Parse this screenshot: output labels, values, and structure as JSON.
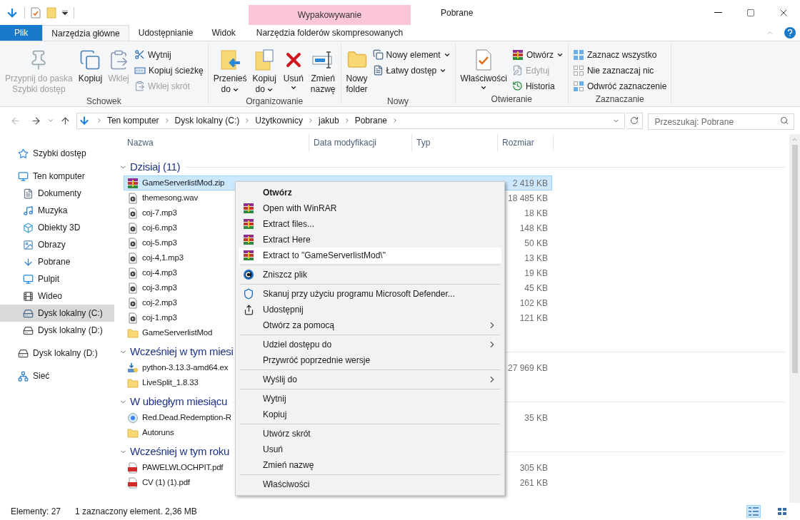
{
  "window": {
    "title": "Pobrane",
    "context_header": "Wypakowywanie"
  },
  "tabs": [
    {
      "label": "Plik",
      "kind": "file",
      "selected": false
    },
    {
      "label": "Narzędzia główne",
      "kind": "tab",
      "selected": true
    },
    {
      "label": "Udostępnianie",
      "kind": "tab",
      "selected": false
    },
    {
      "label": "Widok",
      "kind": "tab",
      "selected": false
    },
    {
      "label": "Narzędzia folderów skompresowanych",
      "kind": "context",
      "selected": false
    }
  ],
  "ribbon": [
    {
      "label": "Schowek",
      "large": [
        {
          "lines": [
            "Przypnij do paska",
            "Szybki dostęp"
          ],
          "kind": "pin",
          "disabled": true,
          "dropdown": false
        },
        {
          "lines": [
            "Kopiuj"
          ],
          "kind": "copy",
          "disabled": false,
          "dropdown": false
        },
        {
          "lines": [
            "Wklej"
          ],
          "kind": "paste",
          "disabled": true,
          "dropdown": false
        }
      ],
      "small": [
        {
          "label": "Wytnij",
          "kind": "cut",
          "disabled": false,
          "dropdown": false
        },
        {
          "label": "Kopiuj ścieżkę",
          "kind": "path",
          "disabled": false,
          "dropdown": false
        },
        {
          "label": "Wklej skrót",
          "kind": "shortcut",
          "disabled": true,
          "dropdown": false
        }
      ]
    },
    {
      "label": "Organizowanie",
      "large": [
        {
          "lines": [
            "Przenieś",
            "do"
          ],
          "kind": "move",
          "disabled": false,
          "dropdown": true
        },
        {
          "lines": [
            "Kopiuj",
            "do"
          ],
          "kind": "copyto",
          "disabled": false,
          "dropdown": true
        },
        {
          "lines": [
            "Usuń"
          ],
          "kind": "delete",
          "disabled": false,
          "dropdown": true
        },
        {
          "lines": [
            "Zmień",
            "nazwę"
          ],
          "kind": "rename",
          "disabled": false,
          "dropdown": false
        }
      ]
    },
    {
      "label": "Nowy",
      "large": [
        {
          "lines": [
            "Nowy",
            "folder"
          ],
          "kind": "folder",
          "disabled": false,
          "dropdown": false
        }
      ],
      "small": [
        {
          "label": "Nowy element",
          "kind": "newitem",
          "disabled": false,
          "dropdown": true
        },
        {
          "label": "Łatwy dostęp",
          "kind": "easy",
          "disabled": false,
          "dropdown": true
        }
      ]
    },
    {
      "label": "Otwieranie",
      "large": [
        {
          "lines": [
            "Właściwości"
          ],
          "kind": "properties",
          "disabled": false,
          "dropdown": true
        }
      ],
      "small": [
        {
          "label": "Otwórz",
          "kind": "winrar",
          "disabled": false,
          "dropdown": true
        },
        {
          "label": "Edytuj",
          "kind": "edit",
          "disabled": true,
          "dropdown": false
        },
        {
          "label": "Historia",
          "kind": "history",
          "disabled": false,
          "dropdown": false
        }
      ]
    },
    {
      "label": "Zaznaczanie",
      "small": [
        {
          "label": "Zaznacz wszystko",
          "kind": "selectall",
          "disabled": false,
          "dropdown": false
        },
        {
          "label": "Nie zaznaczaj nic",
          "kind": "selectnone",
          "disabled": false,
          "dropdown": false
        },
        {
          "label": "Odwróć zaznaczenie",
          "kind": "invert",
          "disabled": false,
          "dropdown": false
        }
      ]
    }
  ],
  "address": {
    "path": [
      "Ten komputer",
      "Dysk lokalny (C:)",
      "Użytkownicy",
      "jakub",
      "Pobrane"
    ],
    "search_placeholder": "Przeszukaj: Pobrane"
  },
  "sidebar": {
    "items": [
      {
        "label": "Szybki dostęp",
        "kind": "star",
        "selected": false
      },
      {
        "label": "Ten komputer",
        "kind": "pc",
        "selected": false,
        "children": [
          {
            "label": "Dokumenty",
            "kind": "docs",
            "selected": false
          },
          {
            "label": "Muzyka",
            "kind": "music",
            "selected": false
          },
          {
            "label": "Obiekty 3D",
            "kind": "cube",
            "selected": false
          },
          {
            "label": "Obrazy",
            "kind": "images",
            "selected": false
          },
          {
            "label": "Pobrane",
            "kind": "download",
            "selected": false
          },
          {
            "label": "Pulpit",
            "kind": "desktop",
            "selected": false
          },
          {
            "label": "Wideo",
            "kind": "video",
            "selected": false
          },
          {
            "label": "Dysk lokalny (C:)",
            "kind": "systemdrive",
            "selected": true
          },
          {
            "label": "Dysk lokalny (D:)",
            "kind": "drive",
            "selected": false
          }
        ]
      },
      {
        "label": "Dysk lokalny (D:)",
        "kind": "drive",
        "selected": false
      },
      {
        "label": "Sieć",
        "kind": "network",
        "selected": false
      }
    ]
  },
  "table": {
    "columns": [
      "Nazwa",
      "Data modyfikacji",
      "Typ",
      "Rozmiar"
    ],
    "groups": [
      {
        "label": "Dzisiaj (11)",
        "rows": [
          {
            "name": "GameServerlistMod.zip",
            "kind": "zip",
            "size": "2 419 KB",
            "selected": true
          },
          {
            "name": "themesong.wav",
            "kind": "audio",
            "size": "18 485 KB",
            "selected": false
          },
          {
            "name": "coj-7.mp3",
            "kind": "audio",
            "size": "18 KB",
            "selected": false
          },
          {
            "name": "coj-6.mp3",
            "kind": "audio",
            "size": "148 KB",
            "selected": false
          },
          {
            "name": "coj-5.mp3",
            "kind": "audio",
            "size": "50 KB",
            "selected": false
          },
          {
            "name": "coj-4,1.mp3",
            "kind": "audio",
            "size": "13 KB",
            "selected": false
          },
          {
            "name": "coj-4.mp3",
            "kind": "audio",
            "size": "19 KB",
            "selected": false
          },
          {
            "name": "coj-3.mp3",
            "kind": "audio",
            "size": "45 KB",
            "selected": false
          },
          {
            "name": "coj-2.mp3",
            "kind": "audio",
            "size": "102 KB",
            "selected": false
          },
          {
            "name": "coj-1.mp3",
            "kind": "audio",
            "size": "121 KB",
            "selected": false
          },
          {
            "name": "GameServerlistMod",
            "kind": "folder",
            "size": "",
            "selected": false
          }
        ]
      },
      {
        "label": "Wcześniej w tym miesi",
        "rows": [
          {
            "name": "python-3.13.3-amd64.ex",
            "kind": "exe",
            "size": "27 969 KB",
            "selected": false
          },
          {
            "name": "LiveSplit_1.8.33",
            "kind": "folder",
            "size": "",
            "selected": false
          }
        ]
      },
      {
        "label": "W ubiegłym miesiącu",
        "rows": [
          {
            "name": "Red.Dead.Redemption-R",
            "kind": "disc",
            "size": "35 KB",
            "selected": false
          },
          {
            "name": "Autoruns",
            "kind": "folder",
            "size": "",
            "selected": false
          }
        ]
      },
      {
        "label": "Wcześniej w tym roku",
        "rows": [
          {
            "name": "PAWELWLOCHPIT.pdf",
            "kind": "pdf",
            "size": "305 KB",
            "selected": false
          },
          {
            "name": "CV (1) (1).pdf",
            "kind": "pdf",
            "size": "261 KB",
            "selected": false
          }
        ]
      }
    ]
  },
  "context_menu": {
    "sections": [
      [
        {
          "label": "Otwórz",
          "kind": "none",
          "default": true,
          "submenu": false,
          "selected": false
        },
        {
          "label": "Open with WinRAR",
          "kind": "winrar",
          "default": false,
          "submenu": false,
          "selected": false
        },
        {
          "label": "Extract files...",
          "kind": "winrar",
          "default": false,
          "submenu": false,
          "selected": false
        },
        {
          "label": "Extract Here",
          "kind": "winrar",
          "default": false,
          "submenu": false,
          "selected": false
        },
        {
          "label": "Extract to \"GameServerlistMod\\\"",
          "kind": "winrar",
          "default": false,
          "submenu": false,
          "selected": true
        }
      ],
      [
        {
          "label": "Zniszcz plik",
          "kind": "shred",
          "default": false,
          "submenu": false,
          "selected": false
        }
      ],
      [
        {
          "label": "Skanuj przy użyciu programu Microsoft Defender...",
          "kind": "shield",
          "default": false,
          "submenu": false,
          "selected": false
        },
        {
          "label": "Udostępnij",
          "kind": "share",
          "default": false,
          "submenu": false,
          "selected": false
        },
        {
          "label": "Otwórz za pomocą",
          "kind": "none",
          "default": false,
          "submenu": true,
          "selected": false
        }
      ],
      [
        {
          "label": "Udziel dostępu do",
          "kind": "none",
          "default": false,
          "submenu": true,
          "selected": false
        },
        {
          "label": "Przywróć poprzednie wersje",
          "kind": "none",
          "default": false,
          "submenu": false,
          "selected": false
        }
      ],
      [
        {
          "label": "Wyślij do",
          "kind": "none",
          "default": false,
          "submenu": true,
          "selected": false
        }
      ],
      [
        {
          "label": "Wytnij",
          "kind": "none",
          "default": false,
          "submenu": false,
          "selected": false
        },
        {
          "label": "Kopiuj",
          "kind": "none",
          "default": false,
          "submenu": false,
          "selected": false
        }
      ],
      [
        {
          "label": "Utwórz skrót",
          "kind": "none",
          "default": false,
          "submenu": false,
          "selected": false
        },
        {
          "label": "Usuń",
          "kind": "none",
          "default": false,
          "submenu": false,
          "selected": false
        },
        {
          "label": "Zmień nazwę",
          "kind": "none",
          "default": false,
          "submenu": false,
          "selected": false
        }
      ],
      [
        {
          "label": "Właściwości",
          "kind": "none",
          "default": false,
          "submenu": false,
          "selected": false
        }
      ]
    ]
  },
  "status_bar": {
    "count": "Elementy: 27",
    "selection": "1 zaznaczony element. 2,36 MB",
    "views": [
      {
        "kind": "details",
        "selected": true
      },
      {
        "kind": "tiles",
        "selected": false
      }
    ]
  }
}
